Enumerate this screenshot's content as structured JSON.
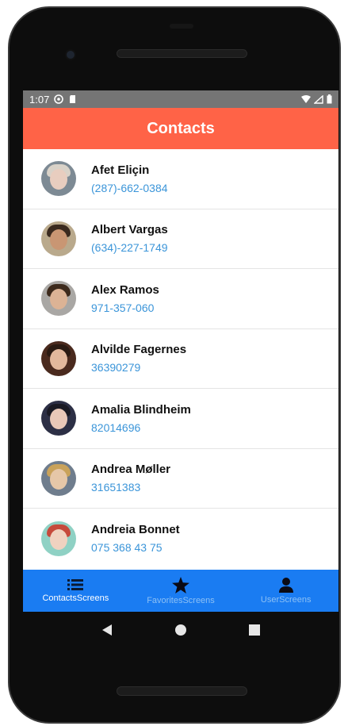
{
  "status_bar": {
    "time": "1:07"
  },
  "header": {
    "title": "Contacts"
  },
  "contacts": [
    {
      "name": "Afet Eliçin",
      "phone": "(287)-662-0384",
      "skin": "#e8cdbf",
      "hair": "#d9d2c8",
      "bg": "#7d8a94"
    },
    {
      "name": "Albert Vargas",
      "phone": "(634)-227-1749",
      "skin": "#c99673",
      "hair": "#3a2a1f",
      "bg": "#b9a98c"
    },
    {
      "name": "Alex Ramos",
      "phone": "971-357-060",
      "skin": "#dcb395",
      "hair": "#3d2a1c",
      "bg": "#a9a7a4"
    },
    {
      "name": "Alvilde Fagernes",
      "phone": "36390279",
      "skin": "#e2b89c",
      "hair": "#2a1a12",
      "bg": "#4a2a1e"
    },
    {
      "name": "Amalia Blindheim",
      "phone": "82014696",
      "skin": "#e9c8b8",
      "hair": "#1a1a24",
      "bg": "#2c2f45"
    },
    {
      "name": "Andrea Møller",
      "phone": "31651383",
      "skin": "#e6c7a8",
      "hair": "#c9a25a",
      "bg": "#6f7d8d"
    },
    {
      "name": "Andreia Bonnet",
      "phone": "075 368 43 75",
      "skin": "#f0d2c0",
      "hair": "#c64a3c",
      "bg": "#8fd1c4"
    }
  ],
  "tabs": [
    {
      "label": "ContactsScreens",
      "icon": "list-icon",
      "active": true
    },
    {
      "label": "FavoritesScreens",
      "icon": "star-icon",
      "active": false
    },
    {
      "label": "UserScreens",
      "icon": "person-icon",
      "active": false
    }
  ],
  "colors": {
    "header": "#ff6347",
    "tab_bar": "#1a7cf2",
    "phone_text": "#3b95d9"
  }
}
